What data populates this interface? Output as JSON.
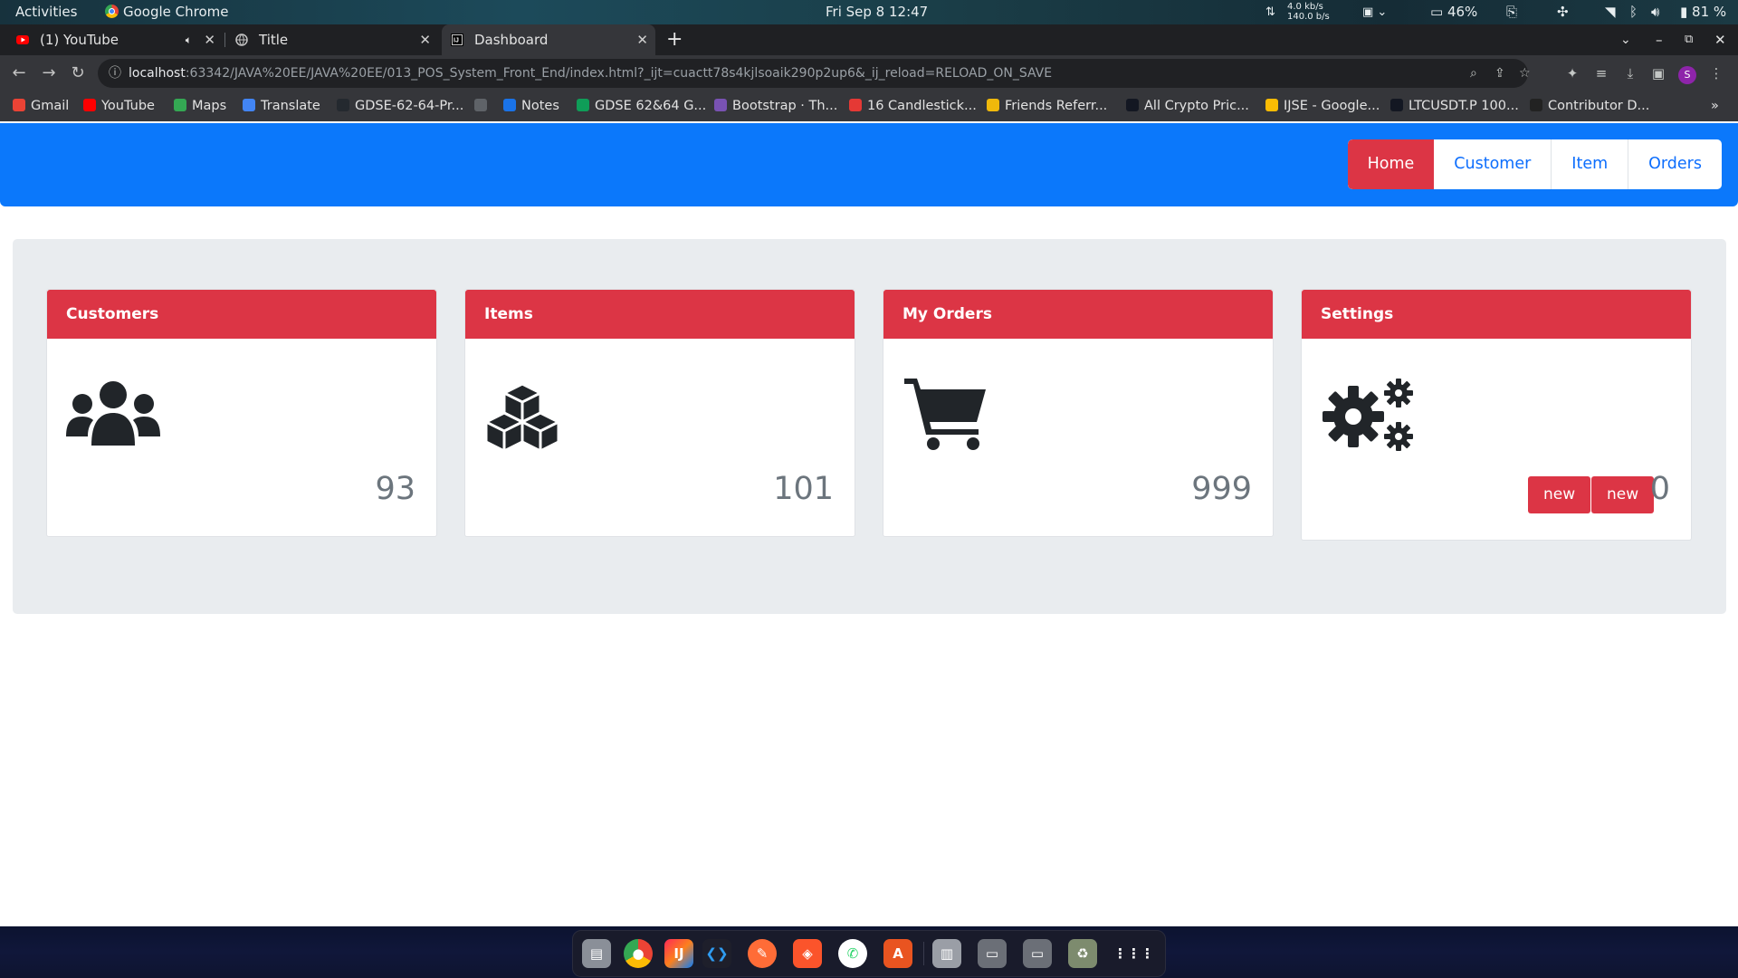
{
  "system_bar": {
    "activities": "Activities",
    "app_name": "Google Chrome",
    "datetime": "Fri Sep 8  12:47",
    "net_up": "4.0 kb/s",
    "net_down": "140.0 b/s",
    "cpu": "46%",
    "battery": "81 %"
  },
  "tabs": [
    {
      "title": "(1) YouTube",
      "active": false
    },
    {
      "title": "Title",
      "active": false
    },
    {
      "title": "Dashboard",
      "active": true
    }
  ],
  "address_bar": {
    "host": "localhost",
    "path": ":63342/JAVA%20EE/JAVA%20EE/013_POS_System_Front_End/index.html?_ijt=cuactt78s4kjlsoaik290p2up6&_ij_reload=RELOAD_ON_SAVE",
    "profile_letter": "S"
  },
  "bookmarks": [
    {
      "label": "Gmail",
      "color": "#ea4335"
    },
    {
      "label": "YouTube",
      "color": "#ff0000"
    },
    {
      "label": "Maps",
      "color": "#34a853"
    },
    {
      "label": "Translate",
      "color": "#4285f4"
    },
    {
      "label": "GDSE-62-64-Pr...",
      "color": "#24292f"
    },
    {
      "label": "",
      "color": "#5f6368"
    },
    {
      "label": "Notes",
      "color": "#1a73e8"
    },
    {
      "label": "GDSE 62&64 G...",
      "color": "#0f9d58"
    },
    {
      "label": "Bootstrap · Th...",
      "color": "#7952b3"
    },
    {
      "label": "16 Candlestick...",
      "color": "#e53935"
    },
    {
      "label": "Friends Referr...",
      "color": "#f0b90b"
    },
    {
      "label": "All Crypto Pric...",
      "color": "#131722"
    },
    {
      "label": "IJSE - Google...",
      "color": "#fbbc04"
    },
    {
      "label": "LTCUSDT.P 100...",
      "color": "#131722"
    },
    {
      "label": "Contributor D...",
      "color": "#222222"
    }
  ],
  "navbar": {
    "links": [
      "Home",
      "Customer",
      "Item",
      "Orders"
    ],
    "active": "Home"
  },
  "cards": [
    {
      "title": "Customers",
      "count": "93",
      "icon": "users-icon"
    },
    {
      "title": "Items",
      "count": "101",
      "icon": "cubes-icon"
    },
    {
      "title": "My Orders",
      "count": "999",
      "icon": "cart-icon"
    },
    {
      "title": "Settings",
      "count": "0",
      "icon": "gears-icon",
      "buttons": [
        "new",
        "new"
      ]
    }
  ],
  "dock_apps": [
    "files",
    "chrome",
    "intellij",
    "vscode",
    "postman",
    "brave",
    "whatsapp",
    "app-center",
    "disk",
    "ssd-1",
    "ssd-2",
    "trash",
    "app-grid"
  ]
}
